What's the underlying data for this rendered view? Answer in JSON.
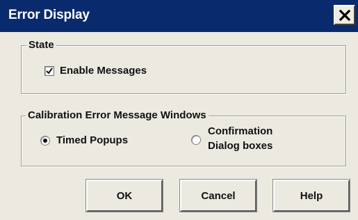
{
  "window": {
    "title": "Error Display"
  },
  "state_group": {
    "label": "State",
    "enable_messages": {
      "label": "Enable Messages",
      "checked": true
    }
  },
  "calibration_group": {
    "label": "Calibration Error Message Windows",
    "timed_popups": {
      "label": "Timed Popups",
      "selected": true
    },
    "confirmation": {
      "label_line1": "Confirmation",
      "label_line2": "Dialog boxes",
      "selected": false
    }
  },
  "buttons": {
    "ok": "OK",
    "cancel": "Cancel",
    "help": "Help"
  },
  "colors": {
    "titlebar": "#0a2a6e",
    "dialog_bg": "#ece9e1"
  }
}
